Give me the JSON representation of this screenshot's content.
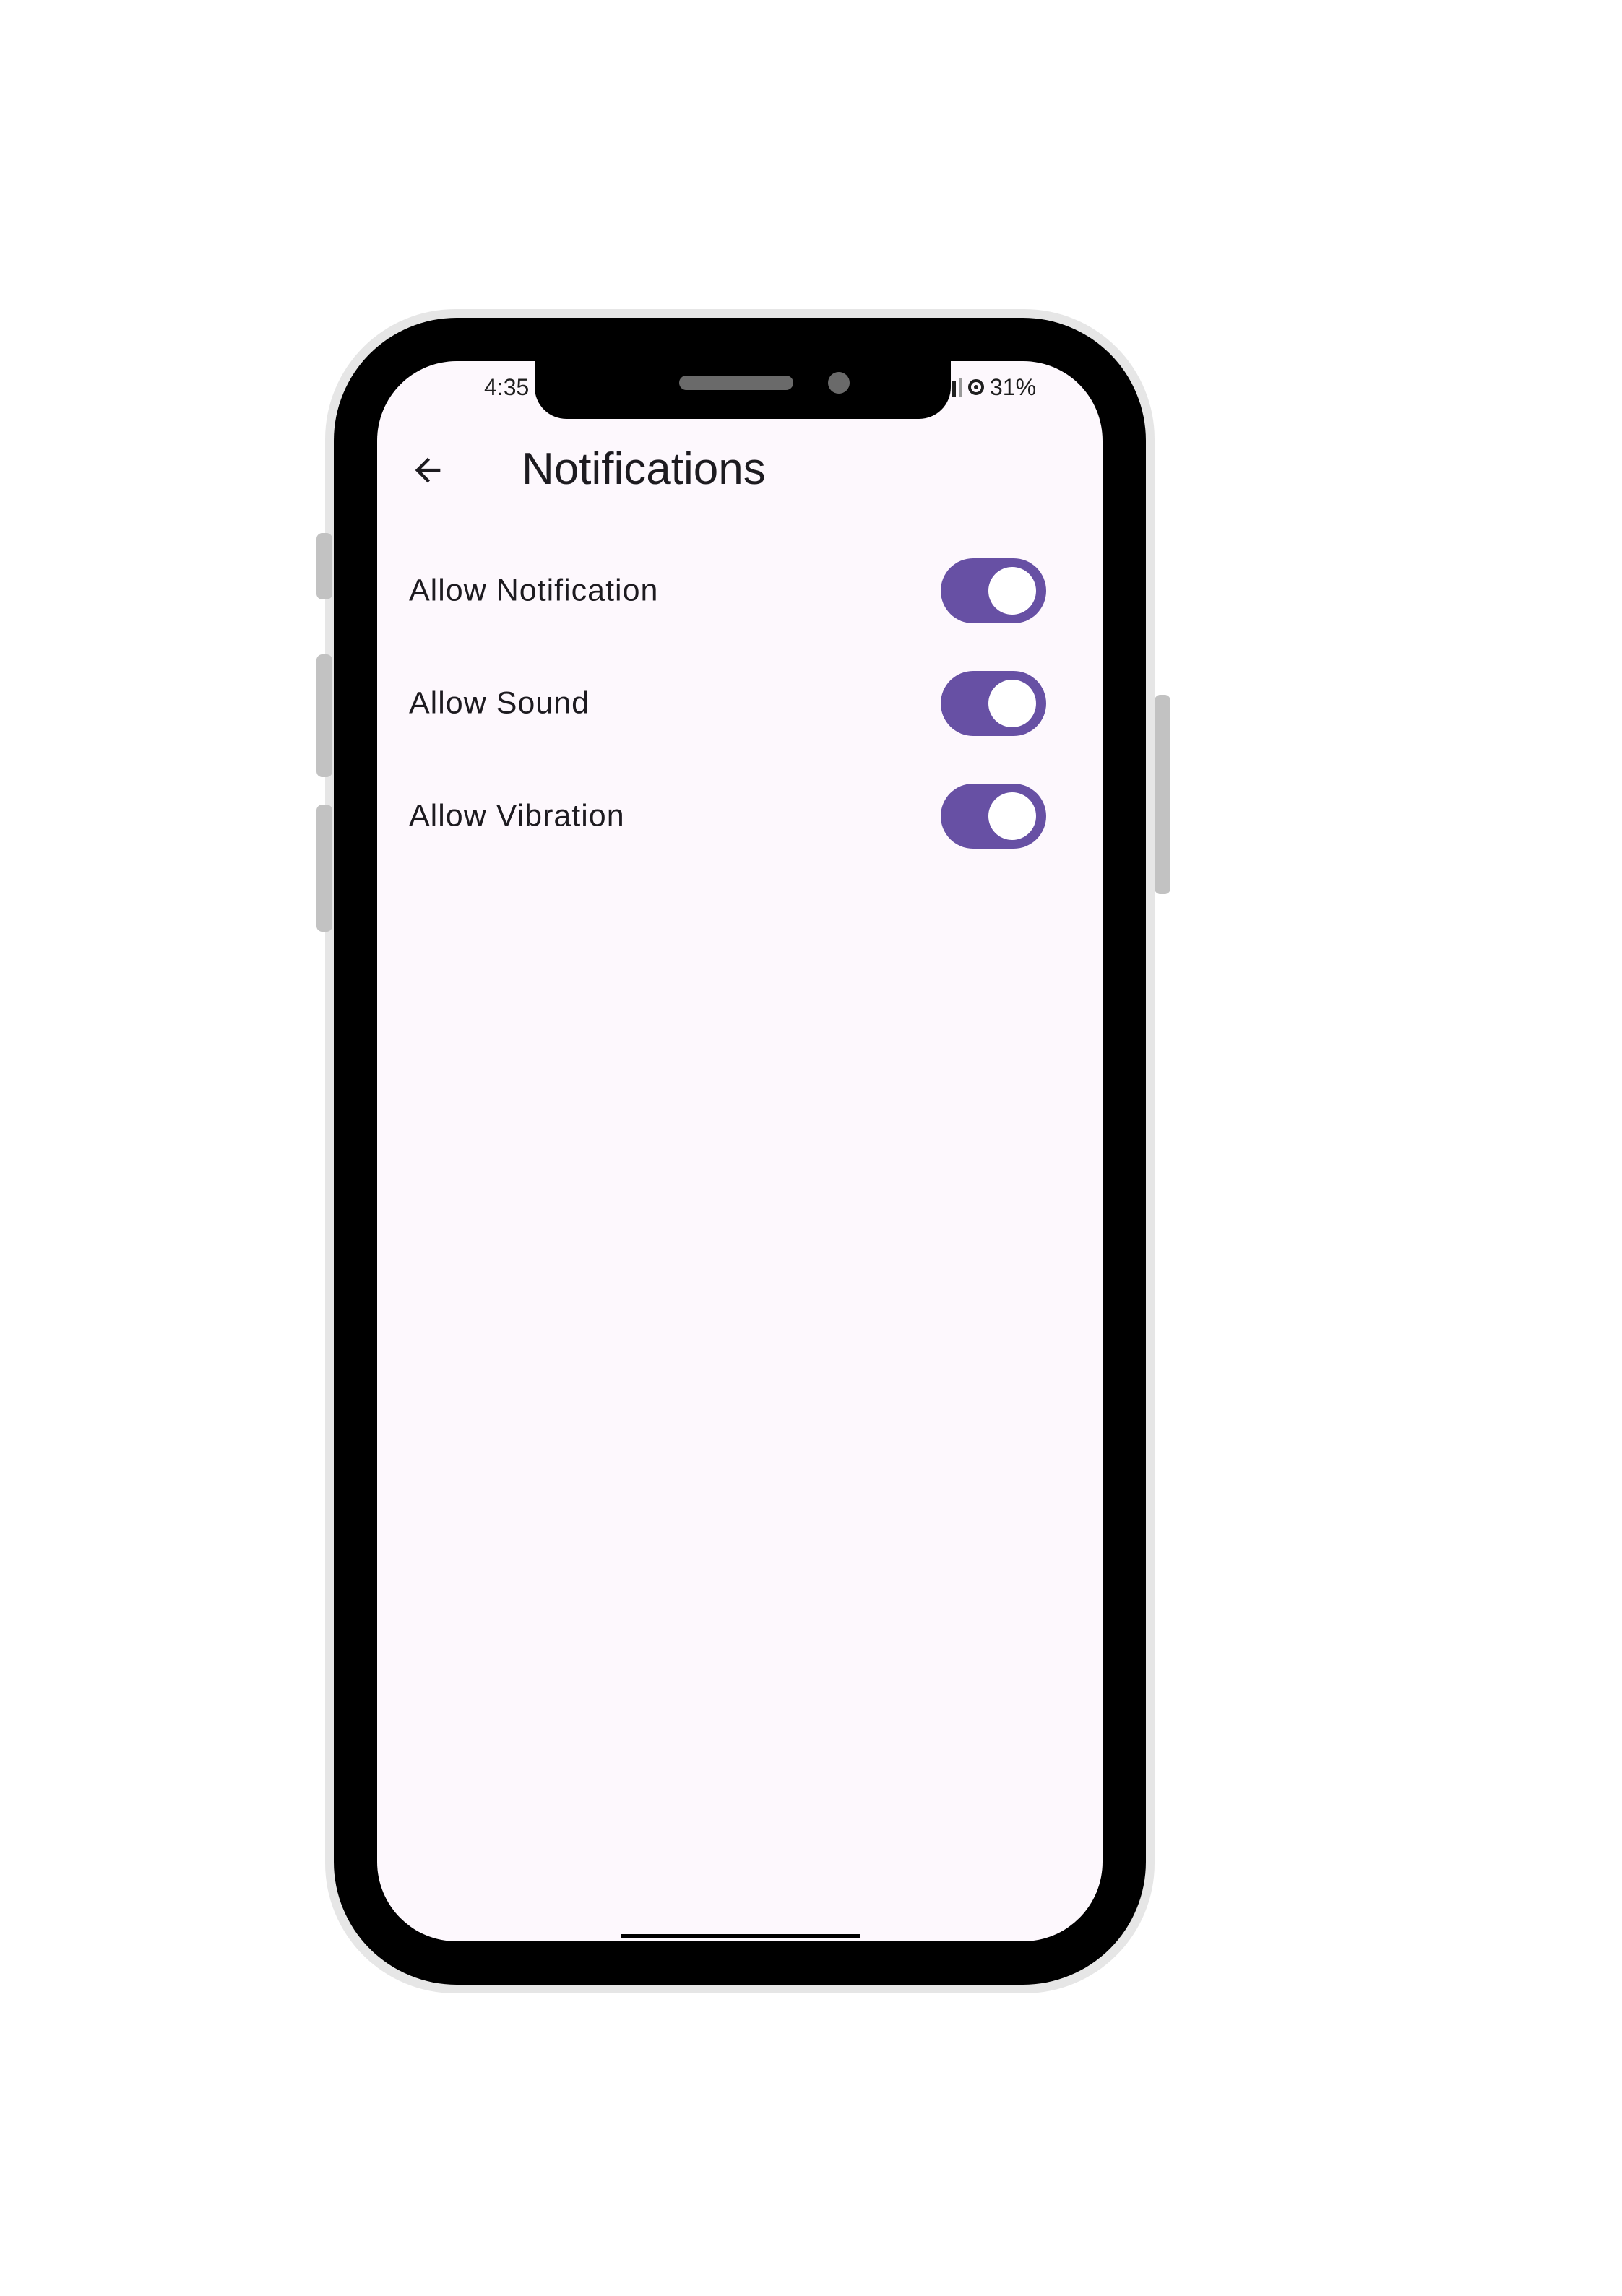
{
  "status_bar": {
    "time": "4:35",
    "battery_percent": "31%",
    "signal_icon": "cell-signal-icon",
    "battery_icon": "battery-ring-icon"
  },
  "app_bar": {
    "back_icon": "arrow-back-icon",
    "title": "Notifications"
  },
  "settings": {
    "items": [
      {
        "label": "Allow Notification",
        "enabled": true
      },
      {
        "label": "Allow Sound",
        "enabled": true
      },
      {
        "label": "Allow Vibration",
        "enabled": true
      }
    ]
  },
  "colors": {
    "accent": "#6750a4",
    "screen_background": "#fdf8fd",
    "text": "#1d1b20",
    "frame": "#000000"
  }
}
